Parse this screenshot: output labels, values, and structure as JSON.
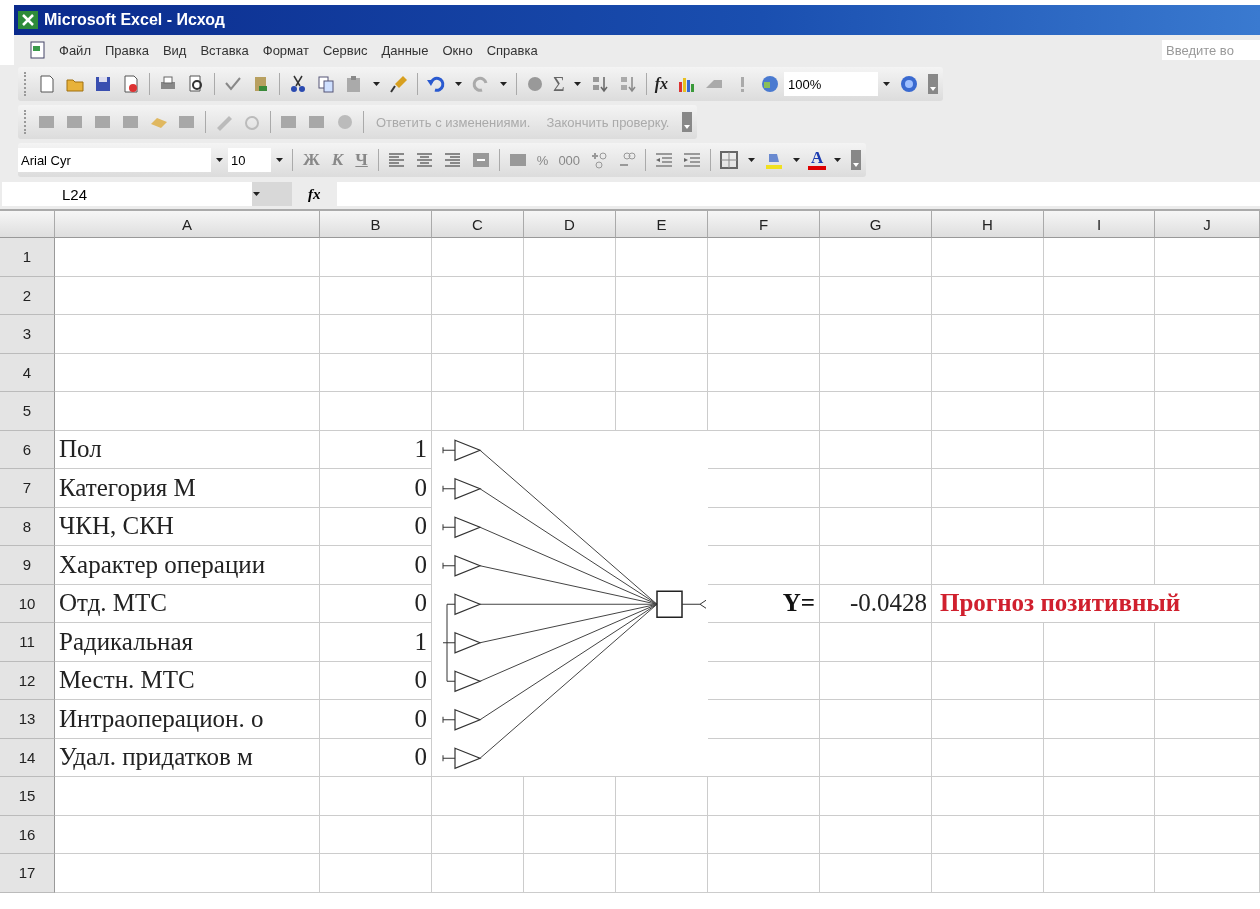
{
  "window": {
    "title": "Microsoft Excel - Исход"
  },
  "menu": {
    "items": [
      "Файл",
      "Правка",
      "Вид",
      "Вставка",
      "Формат",
      "Сервис",
      "Данные",
      "Окно",
      "Справка"
    ],
    "help_search": {
      "placeholder": "Введите во"
    }
  },
  "standard_toolbar": {
    "sum_symbol": "Σ",
    "function_symbol": "fx",
    "zoom": "100%"
  },
  "review_toolbar": {
    "buttons": [
      {
        "label": "Ответить с изменениями.",
        "disabled": true
      },
      {
        "label": "Закончить проверку.",
        "disabled": true
      }
    ]
  },
  "formatting_toolbar": {
    "font": "Arial Cyr",
    "size": "10",
    "bold": "Ж",
    "italic": "К",
    "underline": "Ч",
    "percent": "%",
    "thousands": "000",
    "font_color": "A"
  },
  "formula_bar": {
    "name_box": "L24",
    "function_symbol": "fx"
  },
  "columns": [
    "A",
    "B",
    "C",
    "D",
    "E",
    "F",
    "G",
    "H",
    "I",
    "J"
  ],
  "rows": [
    {
      "number": "1"
    },
    {
      "number": "2"
    },
    {
      "number": "3"
    },
    {
      "number": "4"
    },
    {
      "number": "5"
    },
    {
      "number": "6",
      "cells": {
        "A": {
          "text": "Пол"
        },
        "B": {
          "text": "1"
        }
      }
    },
    {
      "number": "7",
      "cells": {
        "A": {
          "text": "Категория М"
        },
        "B": {
          "text": "0"
        }
      }
    },
    {
      "number": "8",
      "cells": {
        "A": {
          "text": "ЧКН, СКН"
        },
        "B": {
          "text": "0"
        }
      }
    },
    {
      "number": "9",
      "cells": {
        "A": {
          "text": "Характер операции"
        },
        "B": {
          "text": "0"
        }
      }
    },
    {
      "number": "10",
      "cells": {
        "A": {
          "text": "Отд. МТС"
        },
        "B": {
          "text": "0"
        },
        "F": {
          "text": "Y=",
          "bold": true,
          "color": "#111111"
        },
        "G": {
          "text": "-0.0428"
        },
        "H": {
          "text": "Прогноз позитивный",
          "bold": true,
          "color": "#d0202e"
        }
      }
    },
    {
      "number": "11",
      "cells": {
        "A": {
          "text": "Радикальная"
        },
        "B": {
          "text": "1"
        }
      }
    },
    {
      "number": "12",
      "cells": {
        "A": {
          "text": "Местн. МТС"
        },
        "B": {
          "text": "0"
        }
      }
    },
    {
      "number": "13",
      "cells": {
        "A": {
          "text": "Интраоперацион. о"
        },
        "B": {
          "text": "0"
        }
      }
    },
    {
      "number": "14",
      "cells": {
        "A": {
          "text": "Удал. придатков м"
        },
        "B": {
          "text": "0"
        }
      }
    },
    {
      "number": "15"
    },
    {
      "number": "16"
    },
    {
      "number": "17"
    }
  ]
}
